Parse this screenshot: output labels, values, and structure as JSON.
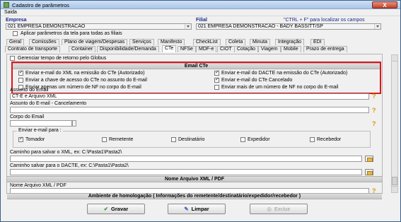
{
  "window": {
    "title": "Cadastro de parâmetros",
    "close": "X"
  },
  "menu": {
    "item": "Saida"
  },
  "header": {
    "empresa_label": "Empresa",
    "empresa_value": "021 EMPRESA DEMONSTRACAO",
    "filial_label": "Filial",
    "filial_value": "021 EMPRESA DEMONSTRACAO - BADY BASSITT/SP",
    "shortcut_hint": "\"CTRL + F\" para localizar os campos",
    "apply_all_label": "Aplicar parâmetros da tela para todas as filiais"
  },
  "tabs_row1": [
    "Geral",
    "Comissões",
    "Plano de viagem/Despesas",
    "Serviços",
    "Manifesto",
    "CheckList",
    "Coleta",
    "Minuta",
    "Integração",
    "EDI"
  ],
  "tabs_row2": [
    "Contrato de transporte",
    "Container",
    "Disponibilidade/Demanda",
    "CTe",
    "NFSe",
    "MDF-e",
    "CIOT",
    "Cotação",
    "Viagem",
    "Mobile",
    "Prazo de entrega"
  ],
  "panel": {
    "gerenciar_label": "Gerenciar tempo de retorno pelo Globus",
    "email_cte_header": "Email CTe",
    "checks": {
      "xml_autorizado": "Enviar e-mail do XML na emissão do CTe (Autorizado)",
      "dacte_autorizado": "Enviar e-mail do DACTE na emissão do CTe (Autorizado)",
      "chave_assunto": "Enviar a chave de acesso do CTe no assunto do E-mail",
      "dacte_cancelado": "Enviar e-mail do CTe Cancelado",
      "um_nf_corpo": "Enviar apenas um número de NF no corpo do E-mail",
      "mais_nf_corpo": "Enviar mais de um número de NF no corpo do E-mail"
    },
    "assunto_label": "Assunto do Email",
    "assunto_value": "CT-E e Arquivo XML",
    "assunto_cancel_label": "Assunto do E-mail - Cancelamento",
    "corpo_label": "Corpo do Email",
    "enviar_para_label": "Enviar e-mail para :",
    "recipients": [
      "Tomador",
      "Remetente",
      "Destinatário",
      "Expedidor",
      "Recebedor"
    ],
    "caminho_xml_label": "Caminho para salvar o XML, ex: C:\\Pasta1\\Pasta2\\",
    "caminho_dacte_label": "Caminho salvar para o DACTE, ex: C:\\Pasta1\\Pasta2\\",
    "nome_xml_header": "Nome Arquivo XML / PDF",
    "nome_xml_label": "Nome Arquivo XML / PDF",
    "homolog_header": "Ambiente de homologação ( Informações do remetente/destinatário/expedidor/recebedor )"
  },
  "buttons": {
    "gravar": "Gravar",
    "limpar": "Limpar",
    "excluir": "Excluir"
  },
  "colors": {
    "highlight_border": "#e0141c",
    "title_blue": "#1a2a8a",
    "help_icon": "#d89b00"
  }
}
